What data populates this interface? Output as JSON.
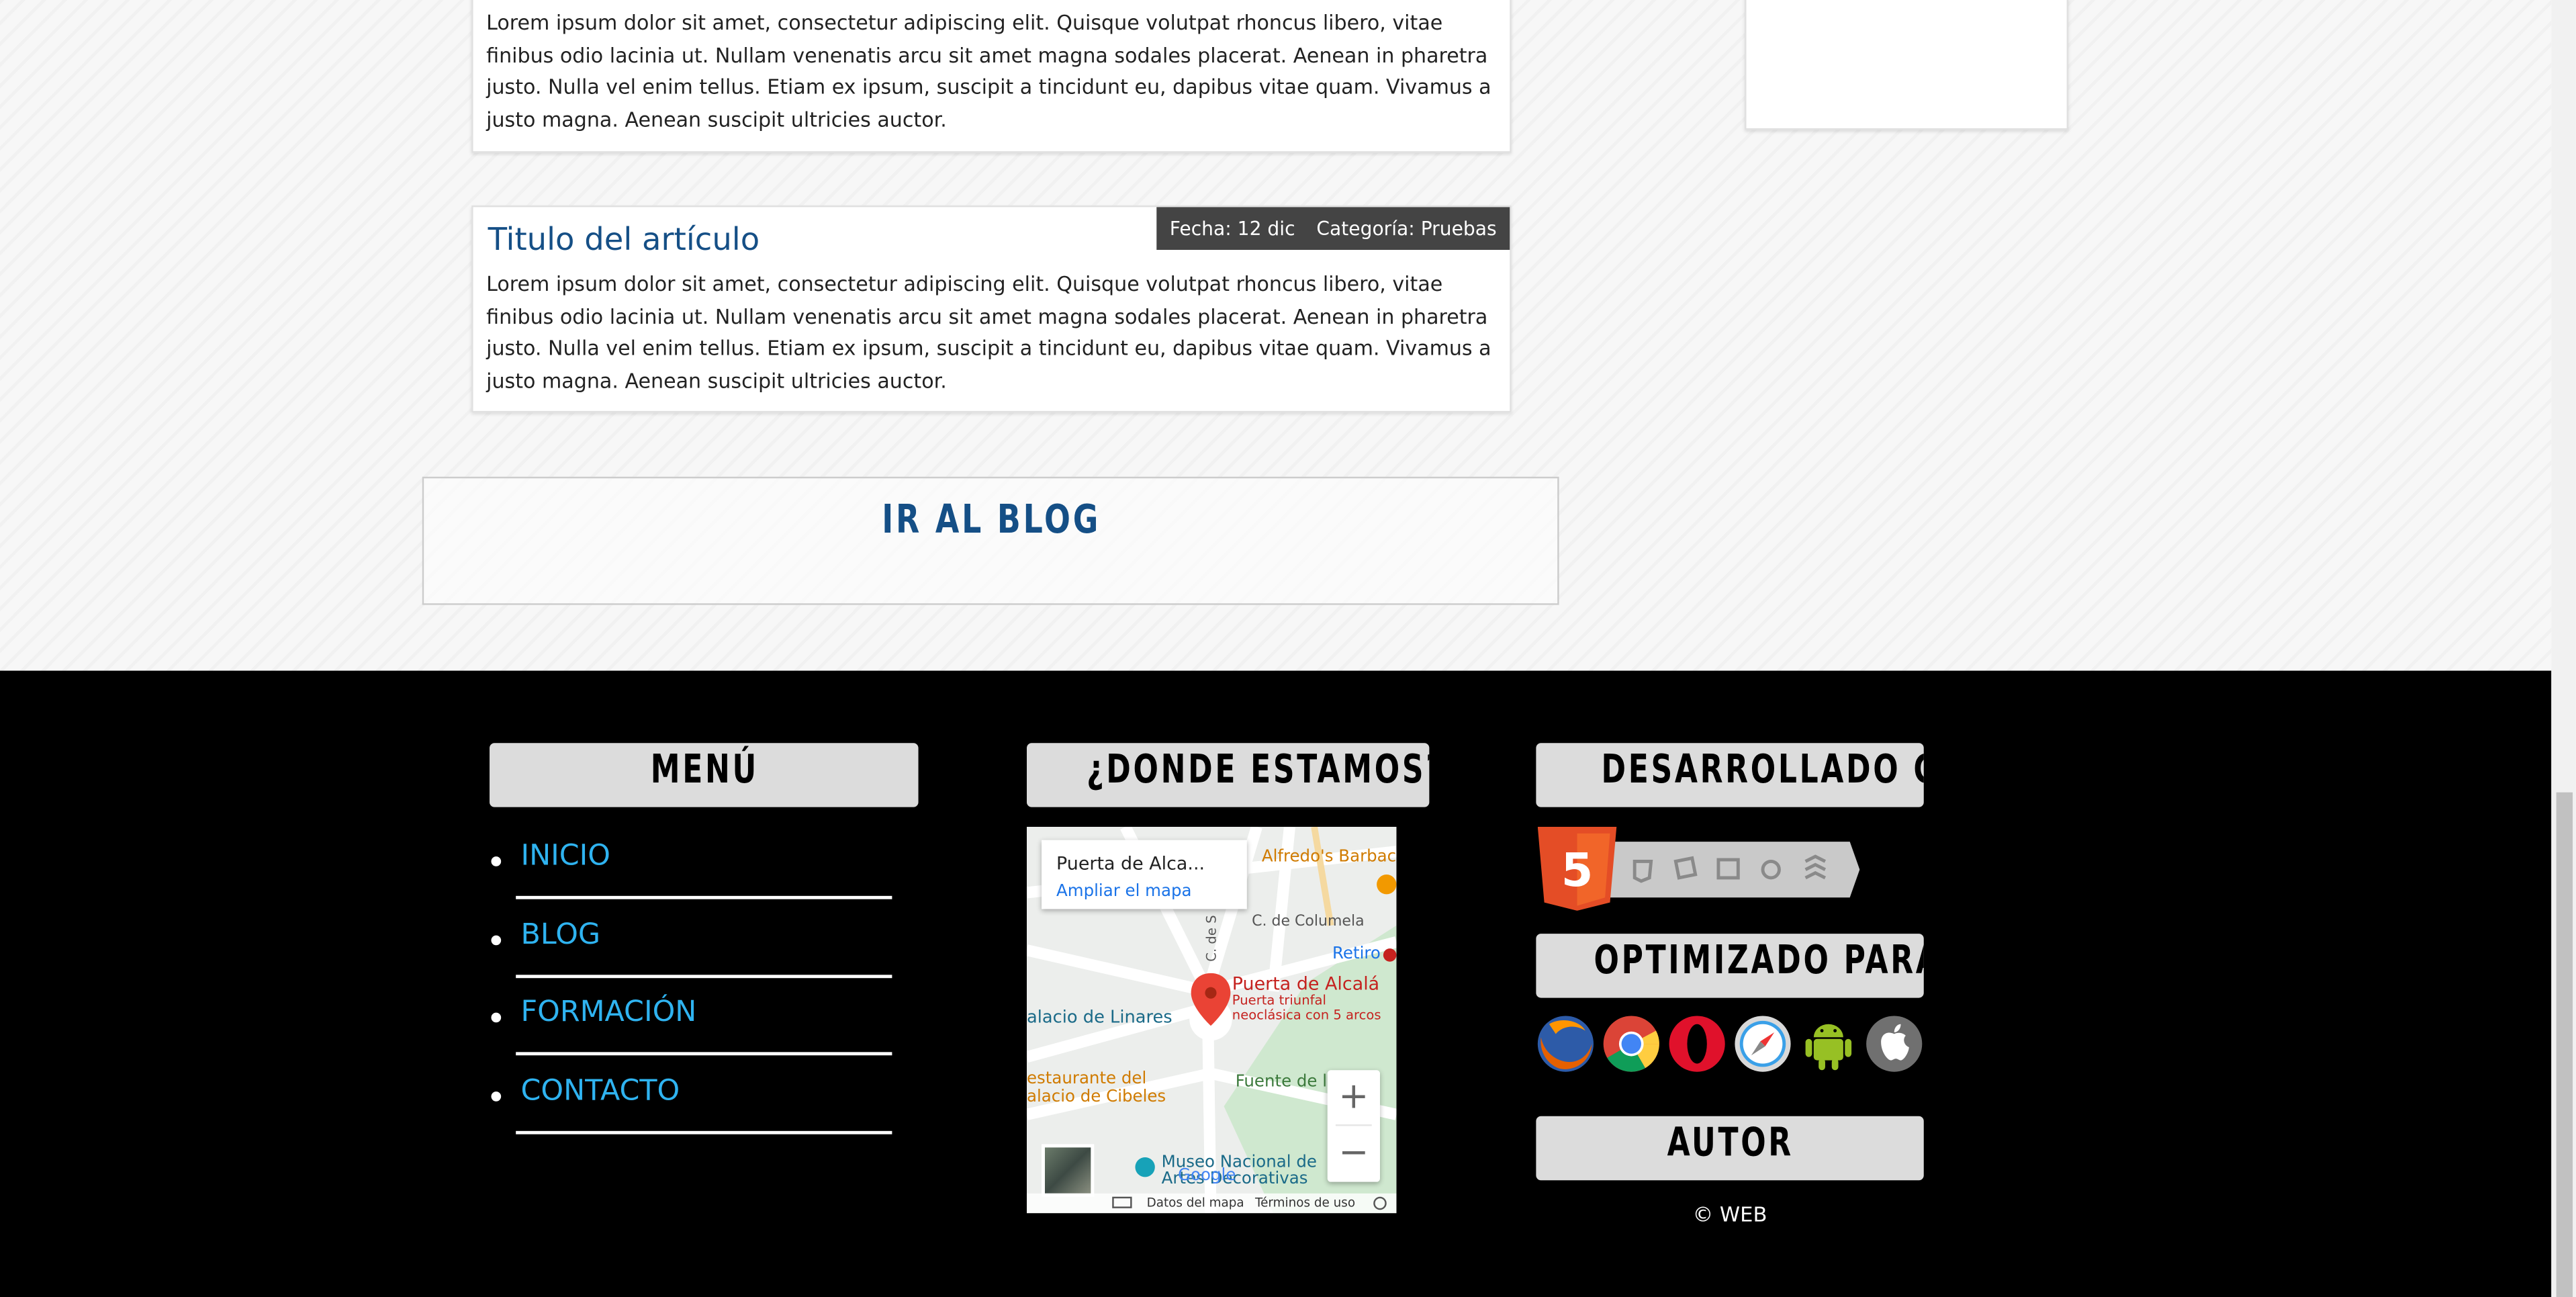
{
  "articles": [
    {
      "text": "Lorem ipsum dolor sit amet, consectetur adipiscing elit. Quisque volutpat rhoncus libero, vitae finibus odio lacinia ut. Nullam venenatis arcu sit amet magna sodales placerat. Aenean in pharetra justo. Nulla vel enim tellus. Etiam ex ipsum, suscipit a tincidunt eu, dapibus vitae quam. Vivamus a justo magna. Aenean suscipit ultricies auctor."
    },
    {
      "title": "Titulo del artículo",
      "date": "Fecha: 12 dic",
      "category_label": "Categoría:",
      "category": "Pruebas",
      "text": "Lorem ipsum dolor sit amet, consectetur adipiscing elit. Quisque volutpat rhoncus libero, vitae finibus odio lacinia ut. Nullam venenatis arcu sit amet magna sodales placerat. Aenean in pharetra justo. Nulla vel enim tellus. Etiam ex ipsum, suscipit a tincidunt eu, dapibus vitae quam. Vivamus a justo magna. Aenean suscipit ultricies auctor."
    }
  ],
  "blog_button": "IR AL BLOG",
  "footer": {
    "menu": {
      "heading": "MENÚ",
      "items": [
        "INICIO",
        "BLOG",
        "FORMACIÓN",
        "CONTACTO"
      ]
    },
    "location": {
      "heading": "¿DONDE ESTAMOS?",
      "map": {
        "place_title": "Puerta de Alca...",
        "enlarge_link": "Ampliar el mapa",
        "pin_label": "Puerta de Alcalá",
        "pin_sub_1": "Puerta triunfal",
        "pin_sub_2": "neoclásica con 5 arcos",
        "streets": {
          "columela": "C. de Columela",
          "salustiano": "C. de S",
          "retiro": "Retiro",
          "linares": "alacio de Linares",
          "cibeles_1": "estaurante del",
          "cibeles_2": "alacio de Cibeles",
          "fuente": "Fuente de l",
          "museo_1": "Museo Nacional de",
          "museo_2": "Artes Decorativas",
          "barbacoa": "Alfredo's Barbac"
        },
        "zoom_in": "+",
        "zoom_out": "−",
        "logo": "Google",
        "footer_data": "Datos del mapa",
        "footer_terms": "Términos de uso"
      }
    },
    "tech": {
      "heading": "DESARROLLADO CON",
      "html5_badge": "5",
      "icons": [
        "html5-icon",
        "css3-icon",
        "3d-effects-icon",
        "device-access-icon",
        "performance-icon",
        "semantics-icon"
      ]
    },
    "optimized": {
      "heading": "OPTIMIZADO PARA",
      "browsers": [
        "firefox-icon",
        "chrome-icon",
        "opera-icon",
        "safari-icon",
        "android-icon",
        "apple-icon"
      ]
    },
    "author": {
      "heading": "AUTOR",
      "copyright": "© WEB"
    }
  },
  "colors": {
    "title_blue": "#154f86",
    "link_cyan": "#2fb3f0",
    "footer_bg": "#000000",
    "heading_box": "#dcdcdc",
    "meta_bg": "#444444"
  }
}
